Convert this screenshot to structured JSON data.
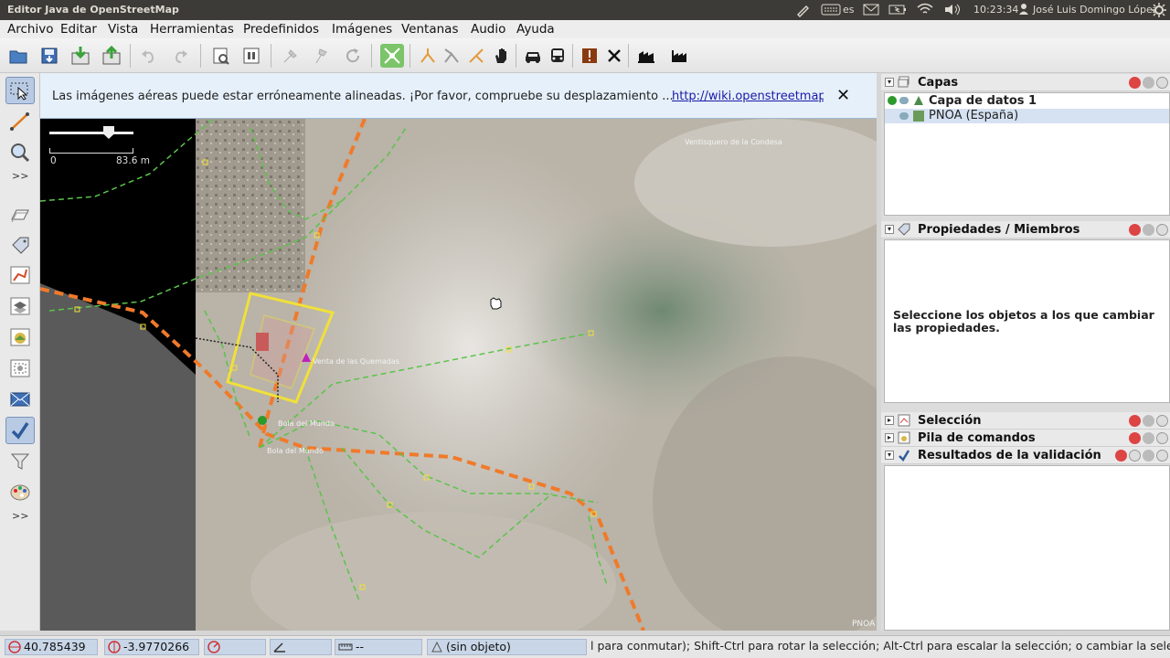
{
  "window": {
    "title": "Editor Java de OpenStreetMap"
  },
  "system": {
    "keyboard": "es",
    "time": "10:23:34",
    "user": "José Luis Domingo López"
  },
  "menu": [
    "Archivo",
    "Editar",
    "Vista",
    "Herramientas",
    "Predefinidos",
    "Imágenes",
    "Ventanas",
    "Audio",
    "Ayuda"
  ],
  "toolbar_icons": [
    "open-icon",
    "save-icon",
    "download-icon",
    "upload-icon",
    "undo-icon",
    "redo-icon",
    "preferences-icon",
    "ticket-icon",
    "shovel-icon",
    "shovel-alt-icon",
    "refresh-icon",
    "validate-icon",
    "junction-icon",
    "split-icon",
    "merge-icon",
    "hand-icon",
    "car-icon",
    "bus-icon",
    "warning-icon",
    "cross-icon",
    "buildings-icon",
    "factory-icon"
  ],
  "left_tools": [
    "select-icon",
    "draw-icon",
    "zoom-icon",
    "area-icon",
    "tag-icon",
    "shape-icon",
    "layer-icon",
    "photo-icon",
    "map-icon",
    "envelope-icon",
    "check-icon",
    "filter-icon",
    "palette-icon"
  ],
  "left_more": ">>",
  "notification": {
    "message": "Las imágenes aéreas puede estar erróneamente alineadas. ¡Por favor, compruebe su desplazamiento ...",
    "link": "http://wiki.openstreetmap",
    "close": "✕"
  },
  "scale": {
    "min": "0",
    "max": "83.6 m"
  },
  "map_labels": {
    "attribution": "PNOA",
    "place1": "Venta de las Quemadas",
    "place2": "Bola del Mundo",
    "place3": "Bola del Mundo",
    "place4": "Ventisquero de la Condesa"
  },
  "panels": {
    "layers": {
      "title": "Capas",
      "items": [
        {
          "name": "Capa de datos 1",
          "active": true
        },
        {
          "name": "PNOA (España)",
          "active": false
        }
      ]
    },
    "properties": {
      "title": "Propiedades / Miembros",
      "empty_text": "Seleccione los objetos a los que cambiar las propiedades."
    },
    "selection": {
      "title": "Selección"
    },
    "commands": {
      "title": "Pila de comandos"
    },
    "validation": {
      "title": "Resultados de la validación"
    }
  },
  "status": {
    "lat": "40.785439",
    "lon": "-3.9770266",
    "angle": "",
    "heading": "",
    "length": "--",
    "object": "(sin objeto)",
    "help": "l para conmutar); Shift-Ctrl para rotar la selección; Alt-Ctrl para escalar la selección; o cambiar la selección"
  },
  "colors": {
    "accent": "#3a6ea5",
    "highway": "#f07a2a",
    "path": "#5ac34a",
    "building": "#f0e03a"
  }
}
